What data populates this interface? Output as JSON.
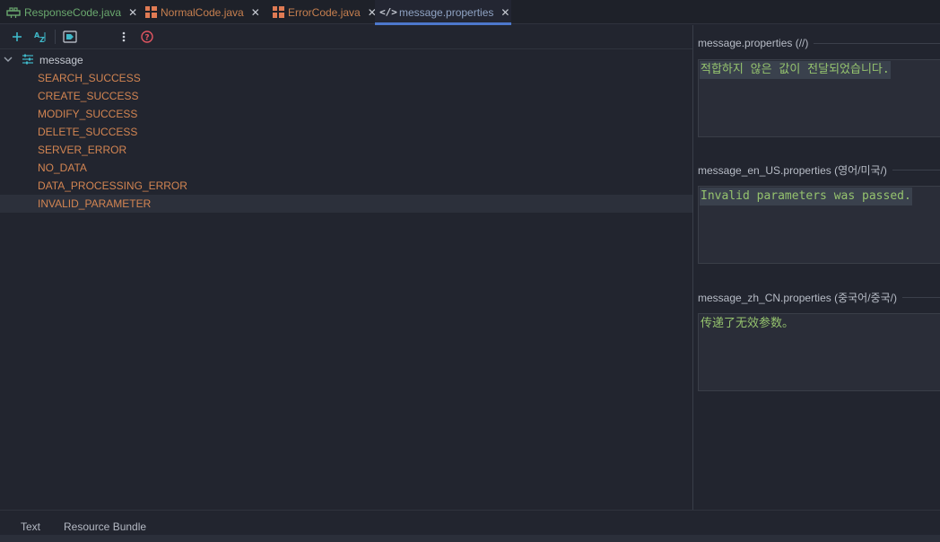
{
  "tabs": [
    {
      "label": "ResponseCode.java",
      "icon": "enum-class-icon",
      "color": "#6aa86e",
      "close": "✕"
    },
    {
      "label": "NormalCode.java",
      "icon": "class-icon",
      "color": "#c67f4f",
      "close": "✕"
    },
    {
      "label": "ErrorCode.java",
      "icon": "class-icon",
      "color": "#c67f4f",
      "close": "✕"
    },
    {
      "label": "message.properties",
      "icon": "code-tag-icon",
      "close": "✕",
      "active": true
    }
  ],
  "toolbar": {
    "add": "add-icon",
    "sort": "sort-alpha-icon",
    "tag": "bookmark-tag-icon",
    "more": "more-vertical-icon",
    "help": "help-icon"
  },
  "tree": {
    "root_label": "message",
    "items": [
      "SEARCH_SUCCESS",
      "CREATE_SUCCESS",
      "MODIFY_SUCCESS",
      "DELETE_SUCCESS",
      "SERVER_ERROR",
      "NO_DATA",
      "DATA_PROCESSING_ERROR",
      "INVALID_PARAMETER"
    ],
    "selected": "INVALID_PARAMETER"
  },
  "locales": [
    {
      "header": "message.properties (//)",
      "value": "적합하지 않은 값이 전달되었습니다."
    },
    {
      "header": "message_en_US.properties (영어/미국/)",
      "value": "Invalid parameters was passed."
    },
    {
      "header": "message_zh_CN.properties (중국어/중국/)",
      "value": "传递了无效参数。"
    }
  ],
  "bottom_tabs": {
    "text": "Text",
    "resource_bundle": "Resource Bundle",
    "active": "Resource Bundle"
  },
  "colors": {
    "accent": "#4d78cc",
    "key_orange": "#d38552",
    "value_green": "#95c36e"
  }
}
